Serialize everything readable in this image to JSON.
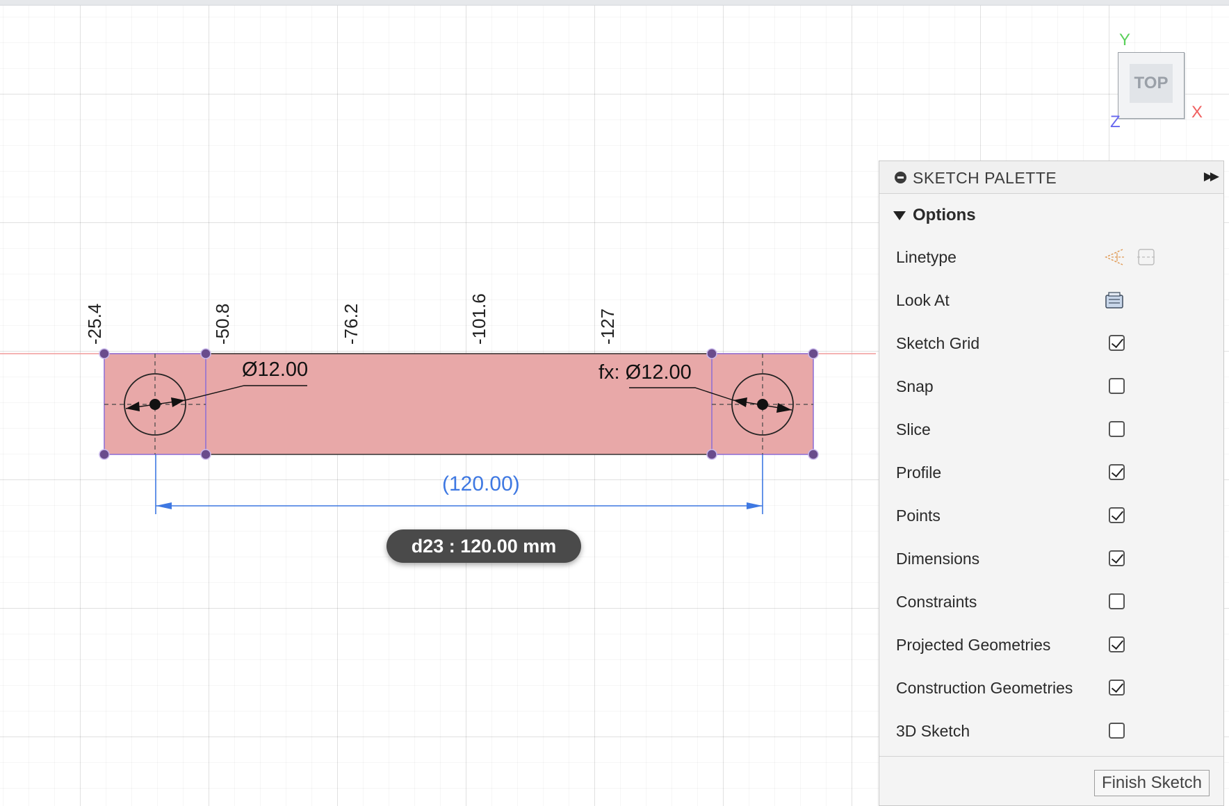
{
  "ruler_labels": [
    "-25.4",
    "-50.8",
    "-76.2",
    "-101.6",
    "-127"
  ],
  "dimensions": {
    "left_diameter": "Ø12.00",
    "right_diameter": "fx: Ø12.00",
    "distance": "(120.00)"
  },
  "tooltip": "d23 : 120.00 mm",
  "viewcube": {
    "face": "TOP",
    "axis_y": "Y",
    "axis_x": "X",
    "axis_z": "Z"
  },
  "palette": {
    "title": "SKETCH PALETTE",
    "section": "Options",
    "linetype_label": "Linetype",
    "look_at_label": "Look At",
    "options": [
      {
        "label": "Sketch Grid",
        "checked": true
      },
      {
        "label": "Snap",
        "checked": false
      },
      {
        "label": "Slice",
        "checked": false
      },
      {
        "label": "Profile",
        "checked": true
      },
      {
        "label": "Points",
        "checked": true
      },
      {
        "label": "Dimensions",
        "checked": true
      },
      {
        "label": "Constraints",
        "checked": false
      },
      {
        "label": "Projected Geometries",
        "checked": true
      },
      {
        "label": "Construction Geometries",
        "checked": true
      },
      {
        "label": "3D Sketch",
        "checked": false
      }
    ],
    "finish_button": "Finish Sketch"
  },
  "colors": {
    "profile_fill": "#e8a8a8",
    "sketch_point": "#6a4c8c",
    "driven_dimension": "#3e78e2",
    "axis_x": "#f06060",
    "axis_y": "#5ad05a",
    "axis_z": "#6666ee"
  }
}
